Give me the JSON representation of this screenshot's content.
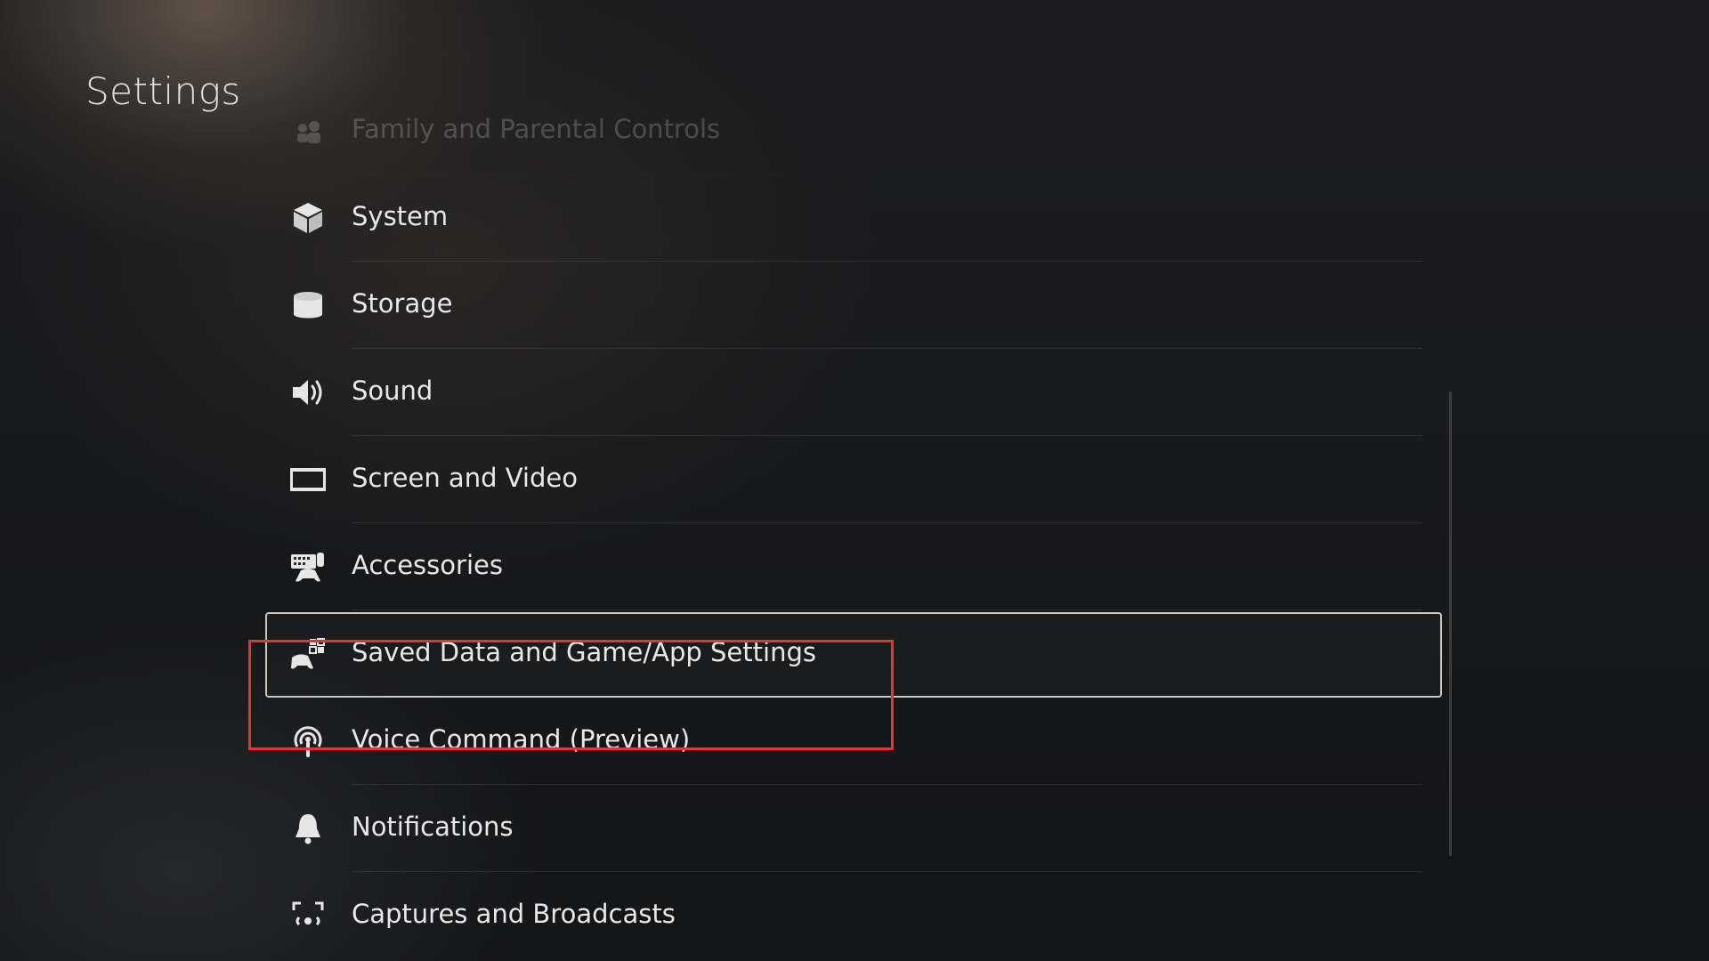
{
  "page": {
    "title": "Settings"
  },
  "menu": {
    "items": [
      {
        "label": "Family and Parental Controls",
        "icon": "family-icon"
      },
      {
        "label": "System",
        "icon": "cube-icon"
      },
      {
        "label": "Storage",
        "icon": "storage-cylinder-icon"
      },
      {
        "label": "Sound",
        "icon": "speaker-icon"
      },
      {
        "label": "Screen and Video",
        "icon": "screen-icon"
      },
      {
        "label": "Accessories",
        "icon": "keyboard-controller-icon"
      },
      {
        "label": "Saved Data and Game/App Settings",
        "icon": "controller-grid-icon"
      },
      {
        "label": "Voice Command (Preview)",
        "icon": "microphone-signal-icon"
      },
      {
        "label": "Notifications",
        "icon": "bell-icon"
      },
      {
        "label": "Captures and Broadcasts",
        "icon": "capture-icon"
      }
    ],
    "selected_index": 6
  },
  "colors": {
    "highlight_box": "#e0353e",
    "selection_frame": "#c9c7bf"
  }
}
